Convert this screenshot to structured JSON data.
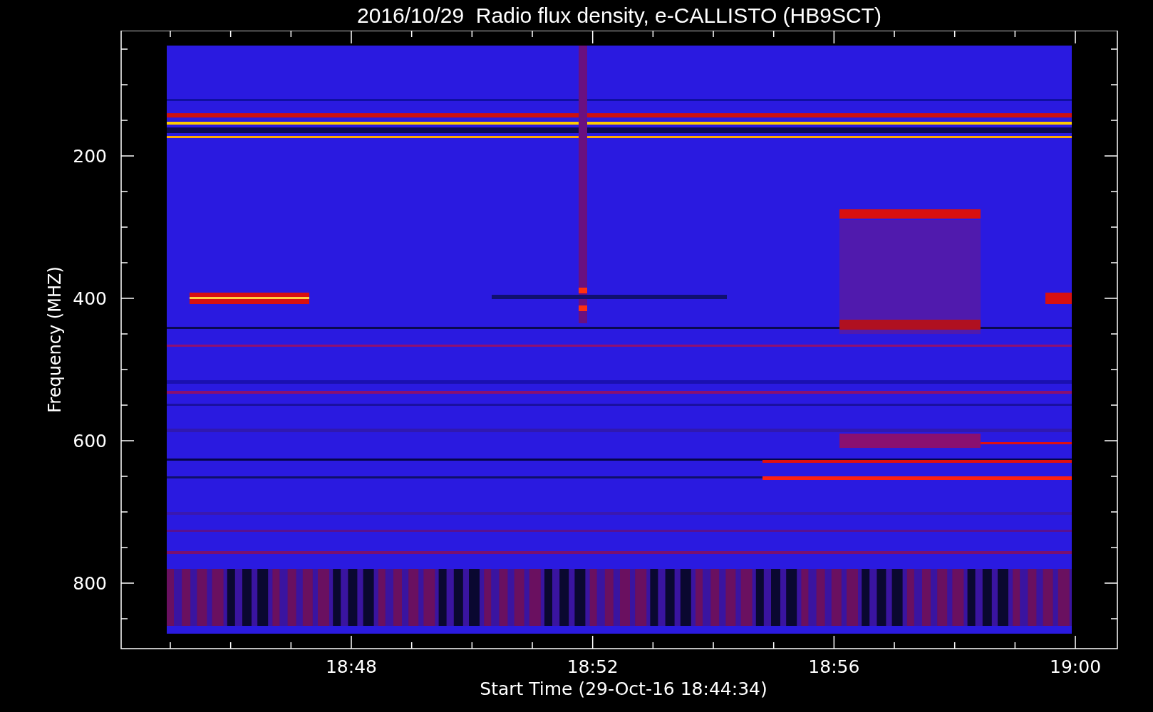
{
  "plot": {
    "title": "2016/10/29  Radio flux density, e-CALLISTO (HB9SCT)",
    "xlabel": "Start Time (29-Oct-16 18:44:34)",
    "ylabel": "Frequency (MHZ)",
    "x_tick_labels": [
      "18:48",
      "18:52",
      "18:56",
      "19:00"
    ],
    "y_tick_labels": [
      "200",
      "400",
      "600",
      "800"
    ]
  }
}
